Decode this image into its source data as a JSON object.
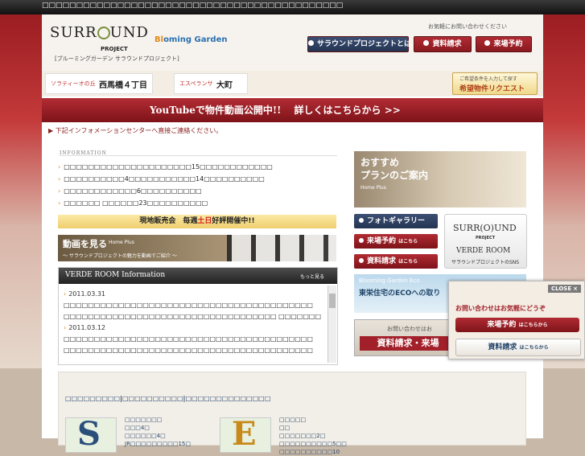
{
  "topbar": {
    "text": "□□□□□□□□□□□□□□□□□□□□□□□□□□□□□□□□□□□□□□□□□□□□"
  },
  "header": {
    "logo_main": "SURR",
    "logo_main_end": "UND",
    "logo_sub": "PROJECT",
    "logo_caption": "[ブルーミングガーデン サラウンドプロジェクト]",
    "logo2_a": "Bl",
    "logo2_b": "oming Garden",
    "contact_caption": "お気軽にお問い合わせください",
    "btn_about": "サラウンドプロジェクトとは",
    "btn_docs": "資料請求",
    "btn_visit": "来場予約"
  },
  "areas": [
    {
      "sub": "ソラティーオの丘",
      "main": "西馬橋４丁目"
    },
    {
      "sub": "エスペランサ",
      "main": "大町"
    }
  ],
  "request": {
    "sub": "ご希望条件を入力して探す",
    "main": "希望物件リクエスト"
  },
  "banner": {
    "text": "YouTubeで物件動画公開中!!　 詳しくはこちらから >>"
  },
  "notice": "下記インフォメーションセンターへ直接ご連絡ください。",
  "info": {
    "heading": "INFORMATION",
    "items": [
      "□□□□□□□□□□□□□□□□□□□□□15□□□□□□□□□□□□",
      "□□□□□□□□□□4□□□□□□□□□□□14□□□□□□□□□□",
      "□□□□□□□□□□□□6□□□□□□□□□□",
      "□□□□□□ □□□□□□23□□□□□□□□□□"
    ]
  },
  "sale": {
    "text_a": "現地販売会　毎週",
    "text_b": "土日",
    "text_c": "好評開催中!!"
  },
  "video": {
    "title": "動画を見る",
    "title_en": "Home Plus",
    "sub": "～ サラウンドプロジェクトの魅力を動画でご紹介 ～"
  },
  "verde": {
    "title": "VERDE ROOM Information",
    "more": "もっと見る",
    "entries": [
      {
        "date": "2011.03.31",
        "lines": [
          "□□□□□□□□□□□□□□□□□□□□□□□□□□□□□□□□□□□□□□□□□",
          "□□□□□□□□□□□□□□□□□□□□□□□□□□□□□□□□□□□ □□□□□□□"
        ]
      },
      {
        "date": "2011.03.12",
        "lines": [
          "□□□□□□□□□□□□□□□□□□□□□□□□□□□□□□□□□□□□□□□□□",
          "□□□□□□□□□□□□□□□□□□□□□□□□□□□□□□□□□□□□□□□□□"
        ]
      }
    ]
  },
  "right": {
    "plan_title": "おすすめ",
    "plan_title2": "プランのご案内",
    "plan_sub": "Home Plus",
    "btn_gallery": "フォトギャラリー",
    "btn_visit": "来場予約",
    "btn_visit_sm": "はこちら",
    "btn_docs": "資料請求",
    "btn_docs_sm": "はこちら",
    "sns_logo": "SURR",
    "sns_logo_end": "UND",
    "sns_project": "PROJECT",
    "sns_verde": "VERDE ROOM",
    "sns_caption": "サラウンドプロジェクトのSNS",
    "eco_sub": "Blooming Garden Eco",
    "eco_main": "東栄住宅のECOへの取り",
    "doc_sub": "お問い合わせはお",
    "doc_main": "資料請求・来場"
  },
  "popup": {
    "close": "CLOSE",
    "close_icon": "×",
    "caption": "お問い合わせはお気軽にどうぞ",
    "btn1": "来場予約",
    "btn1_sm": "はこちらから",
    "btn2": "資料請求",
    "btn2_sm": "はこちらから"
  },
  "bottom": {
    "heading": "□□□□□□□□□|□□□□□□□□□□|□□□□□□□□□□□□□□",
    "props": [
      {
        "letter": "S",
        "name": "□□□□□□□",
        "l1": "□□□4□",
        "l2": "□□□□□□4□",
        "l3": "JR□□□□□□□□□15□"
      },
      {
        "letter": "E",
        "name": "□□□□□",
        "l1": "□□",
        "l2": "□□□□□□□2□",
        "l3": "□□□□□□□□□□5□□",
        "l4": "□□□□□□□□□□10"
      }
    ]
  }
}
